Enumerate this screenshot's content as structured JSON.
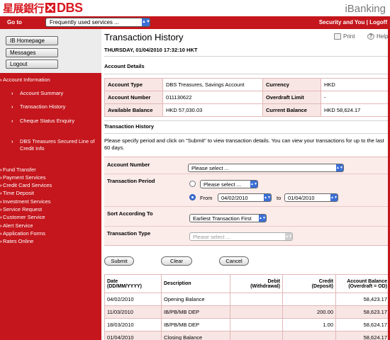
{
  "header": {
    "logo_zh": "星展銀行",
    "logo_en": "DBS",
    "product": "iBanking"
  },
  "navbar": {
    "goto_label": "Go to",
    "quick_select": "Frequently used services ...",
    "top_links": "Security and You | Logoff"
  },
  "sidebar": {
    "buttons": [
      "IB Homepage",
      "Messages",
      "Logout"
    ],
    "account_info": "Account Information",
    "sub_items": [
      "Account Summary",
      "Transaction History",
      "Cheque Status Enquiry",
      "DBS Treasures Secured Line of Credit Info"
    ],
    "main_items": [
      "Fund Transfer",
      "Payment Services",
      "Credit Card Services",
      "Time Deposit",
      "Investment Services",
      "Service Request",
      "Customer Service",
      "Alert Service",
      "Application Forms",
      "Rates Online"
    ]
  },
  "main": {
    "title": "Transaction History",
    "datetime": "THURSDAY, 01/04/2010 17:32:10 HKT",
    "print_label": "Print",
    "help_label": "Help",
    "account_details_heading": "Account Details",
    "account_details": {
      "account_type_label": "Account Type",
      "account_type": "DBS Treasures, Savings Account",
      "currency_label": "Currency",
      "currency": "HKD",
      "account_number_label": "Account Number",
      "account_number": "011130622",
      "overdraft_label": "Overdraft Limit",
      "overdraft": "-",
      "available_label": "Available Balance",
      "available": "HKD 57,030.03",
      "current_label": "Current Balance",
      "current": "HKD 58,624.17"
    },
    "transaction_history_heading": "Transaction History",
    "instructions": "Please specify period and click on \"Submit\" to view transaction details. You can view your transactions for up to the last 60 days.",
    "form": {
      "account_number_label": "Account Number",
      "account_number_value": "Please select ...",
      "period_label": "Transaction Period",
      "period_select_value": "Please select ...",
      "from_label": "From",
      "from_date": "04/02/2010",
      "to_label": "to",
      "to_date": "01/04/2010",
      "sort_label": "Sort According To",
      "sort_value": "Earliest Transaction First",
      "type_label": "Transaction Type",
      "type_value": "Please select ..."
    },
    "buttons": {
      "submit": "Submit",
      "clear": "Clear",
      "cancel": "Cancel"
    },
    "transactions": {
      "headers": {
        "date_1": "Date",
        "date_2": "(DD/MM/YYYY)",
        "description": "Description",
        "debit_1": "Debit",
        "debit_2": "(Withdrawal)",
        "credit_1": "Credit",
        "credit_2": "(Deposit)",
        "balance_1": "Account Balance",
        "balance_2": "(Overdraft = OD)"
      },
      "rows": [
        {
          "date": "04/02/2010",
          "description": "Opening Balance",
          "debit": "",
          "credit": "",
          "balance": "58,423.17"
        },
        {
          "date": "11/03/2010",
          "description": "IB/PB/MB DEP",
          "debit": "",
          "credit": "200.00",
          "balance": "58,623.17"
        },
        {
          "date": "18/03/2010",
          "description": "IB/PB/MB DEP",
          "debit": "",
          "credit": "1.00",
          "balance": "58,624.17"
        },
        {
          "date": "01/04/2010",
          "description": "Closing Balance",
          "debit": "",
          "credit": "",
          "balance": "58,624.17"
        }
      ]
    }
  }
}
